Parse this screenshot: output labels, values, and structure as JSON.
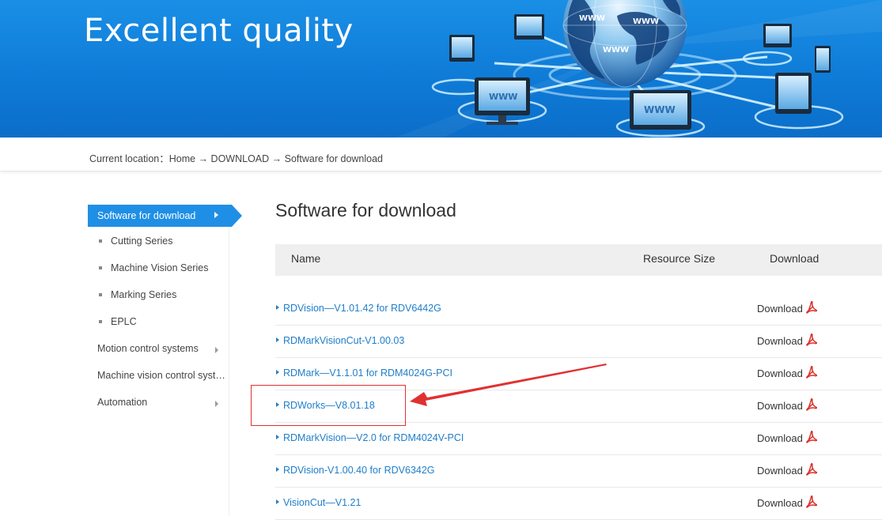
{
  "banner": {
    "title": "Excellent quality",
    "globe_label": "WWW"
  },
  "breadcrumb": {
    "prefix": "Current location：",
    "home": "Home",
    "sep1": " → ",
    "section": "DOWNLOAD",
    "sep2": " → ",
    "current": "Software for download"
  },
  "sidebar": {
    "active": {
      "label": "Software for download",
      "icon": "chevron-right-icon"
    },
    "sub_items": [
      {
        "label": "Cutting Series"
      },
      {
        "label": "Machine Vision Series"
      },
      {
        "label": "Marking Series"
      },
      {
        "label": "EPLC"
      }
    ],
    "top_items": [
      {
        "label": "Motion control systems",
        "has_arrow": true
      },
      {
        "label": "Machine vision control systems",
        "has_arrow": false
      },
      {
        "label": "Automation",
        "has_arrow": true
      }
    ]
  },
  "main": {
    "title": "Software for download",
    "columns": {
      "name": "Name",
      "size": "Resource Size",
      "download": "Download"
    },
    "rows": [
      {
        "name": "RDVision—V1.01.42 for RDV6442G",
        "size": "",
        "download": "Download"
      },
      {
        "name": "RDMarkVisionCut-V1.00.03",
        "size": "",
        "download": "Download"
      },
      {
        "name": "RDMark—V1.1.01 for RDM4024G-PCI",
        "size": "",
        "download": "Download"
      },
      {
        "name": "RDWorks—V8.01.18",
        "size": "",
        "download": "Download"
      },
      {
        "name": "RDMarkVision—V2.0 for RDM4024V-PCI",
        "size": "",
        "download": "Download"
      },
      {
        "name": "RDVision-V1.00.40 for RDV6342G",
        "size": "",
        "download": "Download"
      },
      {
        "name": "VisionCut—V1.21",
        "size": "",
        "download": "Download"
      }
    ]
  },
  "colors": {
    "banner": "#1285e0",
    "accent": "#1f8fe6",
    "link": "#1f7ec9",
    "pdf_icon": "#d9322b",
    "annotation": "#e03131"
  }
}
